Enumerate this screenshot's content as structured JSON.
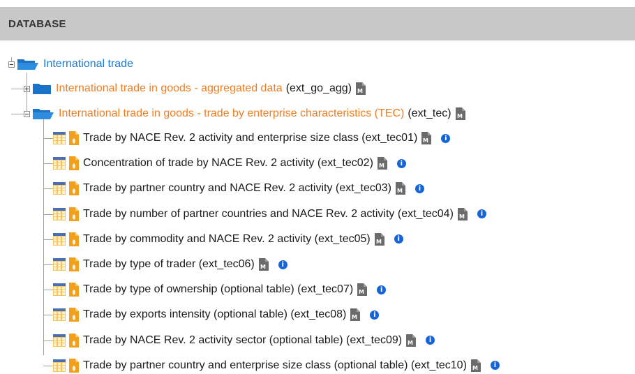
{
  "header": {
    "title": "DATABASE"
  },
  "tree": {
    "root": {
      "label": "International trade"
    },
    "agg": {
      "label": "International trade in goods - aggregated data",
      "code": "(ext_go_agg)"
    },
    "tec": {
      "label": "International trade in goods - trade by enterprise characteristics (TEC)",
      "code": "(ext_tec)"
    },
    "tables": [
      {
        "label": "Trade by NACE Rev. 2 activity and enterprise size class (ext_tec01)"
      },
      {
        "label": "Concentration of trade by NACE Rev. 2 activity (ext_tec02)"
      },
      {
        "label": "Trade by partner country and NACE Rev. 2 activity (ext_tec03)"
      },
      {
        "label": "Trade by number of partner countries and NACE Rev. 2 activity (ext_tec04)"
      },
      {
        "label": "Trade by commodity and NACE Rev. 2 activity (ext_tec05)"
      },
      {
        "label": "Trade by type of trader (ext_tec06)"
      },
      {
        "label": "Trade by type of ownership (optional table) (ext_tec07)"
      },
      {
        "label": "Trade by exports intensity (optional table) (ext_tec08)"
      },
      {
        "label": "Trade by NACE Rev. 2 activity sector (optional table) (ext_tec09)"
      },
      {
        "label": "Trade by partner country and enterprise size class (optional table) (ext_tec10)"
      }
    ]
  },
  "icons": {
    "info_glyph": "i",
    "metadata_glyph": "M"
  },
  "colors": {
    "link_blue": "#1a7ad4",
    "orange": "#ef7d22",
    "info_blue": "#1565d8",
    "header_bg": "#c8c8c8"
  }
}
